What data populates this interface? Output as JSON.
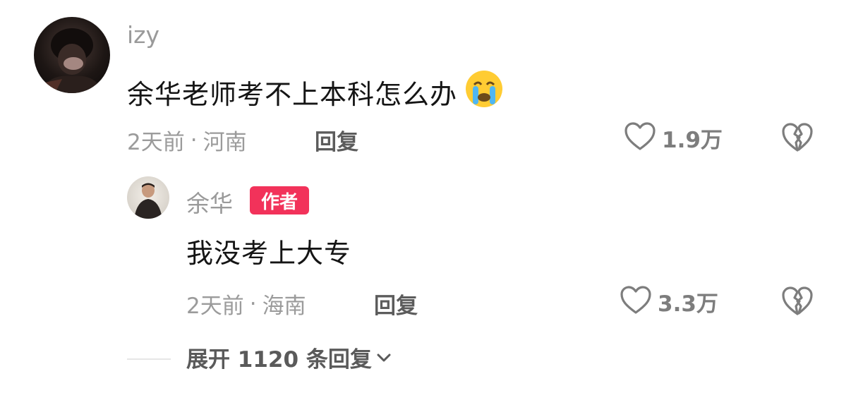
{
  "comment": {
    "username": "izy",
    "text": "余华老师考不上本科怎么办",
    "emoji": "crying-face-emoji",
    "time": "2天前",
    "location": "河南",
    "reply_label": "回复",
    "likes": "1.9万"
  },
  "reply": {
    "username": "余华",
    "badge": "作者",
    "text": "我没考上大专",
    "time": "2天前",
    "location": "海南",
    "reply_label": "回复",
    "likes": "3.3万"
  },
  "expand": {
    "label": "展开 1120 条回复",
    "icon": "chevron-down-icon"
  },
  "separator": "·",
  "colors": {
    "badge_bg": "#f2325a",
    "meta_text": "#9b9b9b",
    "body_text": "#151515"
  }
}
